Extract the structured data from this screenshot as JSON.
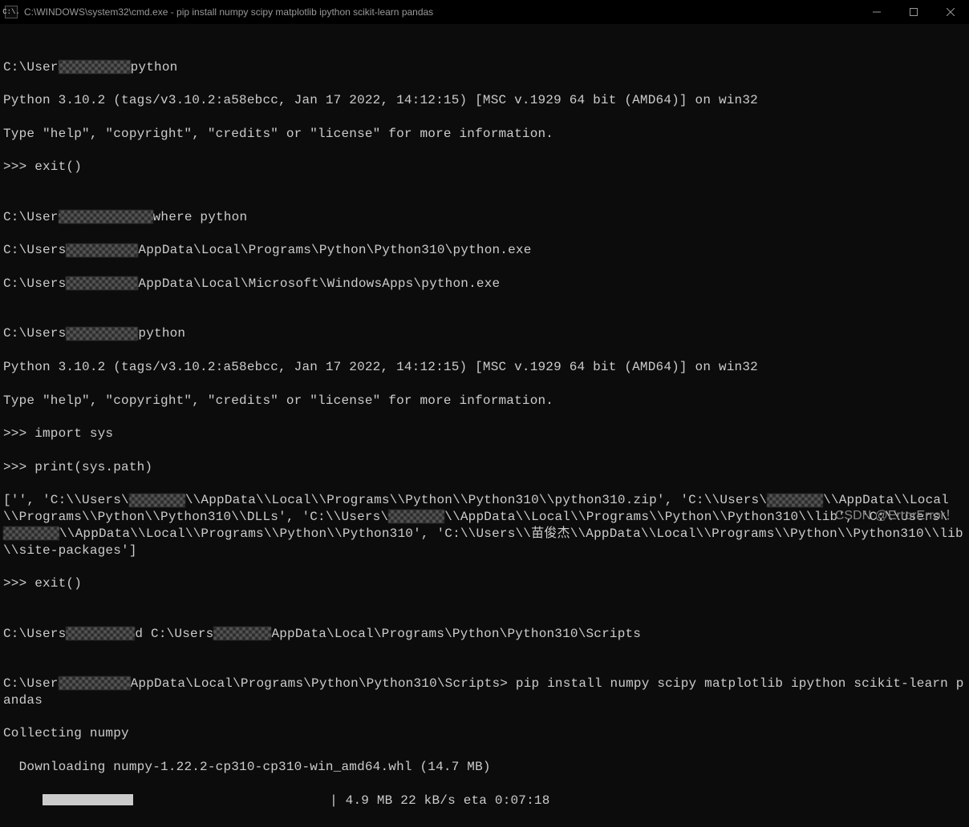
{
  "window": {
    "title": "C:\\WINDOWS\\system32\\cmd.exe - pip  install numpy scipy matplotlib ipython scikit-learn pandas",
    "icon_label": "C:\\."
  },
  "terminal": {
    "blank0": "",
    "line1_pre": "C:\\User",
    "line1_post": "python",
    "line2": "Python 3.10.2 (tags/v3.10.2:a58ebcc, Jan 17 2022, 14:12:15) [MSC v.1929 64 bit (AMD64)] on win32",
    "line3": "Type \"help\", \"copyright\", \"credits\" or \"license\" for more information.",
    "line4": ">>> exit()",
    "blank1": "",
    "line5_pre": "C:\\User",
    "line5_post": "where python",
    "line6_pre": "C:\\Users",
    "line6_post": "AppData\\Local\\Programs\\Python\\Python310\\python.exe",
    "line7_pre": "C:\\Users",
    "line7_post": "AppData\\Local\\Microsoft\\WindowsApps\\python.exe",
    "blank2": "",
    "line8_pre": "C:\\Users",
    "line8_post": "python",
    "line9": "Python 3.10.2 (tags/v3.10.2:a58ebcc, Jan 17 2022, 14:12:15) [MSC v.1929 64 bit (AMD64)] on win32",
    "line10": "Type \"help\", \"copyright\", \"credits\" or \"license\" for more information.",
    "line11": ">>> import sys",
    "line12": ">>> print(sys.path)",
    "line13_a": "['', 'C:\\\\Users\\",
    "line13_b": "\\\\AppData\\\\Local\\\\Programs\\\\Python\\\\Python310\\\\python310.zip', 'C:\\\\Users\\",
    "line13_c": "\\\\AppData\\\\Local\\\\Programs\\\\Python\\\\Python310\\\\DLLs', 'C:\\\\Users\\",
    "line13_d": "\\\\AppData\\\\Local\\\\Programs\\\\Python\\\\Python310\\\\lib', 'C:\\\\Users\\",
    "line13_e": "\\\\AppData\\\\Local\\\\Programs\\\\Python\\\\Python310', 'C:\\\\Users\\\\苗俊杰\\\\AppData\\\\Local\\\\Programs\\\\Python\\\\Python310\\\\lib\\\\site-packages']",
    "line14": ">>> exit()",
    "blank3": "",
    "line15_pre": "C:\\Users",
    "line15_mid": "d C:\\Users",
    "line15_post": "AppData\\Local\\Programs\\Python\\Python310\\Scripts",
    "blank4": "",
    "line16_pre": "C:\\User",
    "line16_post": "AppData\\Local\\Programs\\Python\\Python310\\Scripts> pip install numpy scipy matplotlib ipython scikit-learn pandas",
    "line17": "Collecting numpy",
    "line18": "  Downloading numpy-1.22.2-cp310-cp310-win_amd64.whl (14.7 MB)",
    "progress_prefix": "     ",
    "progress_filled_width": "113",
    "progress_total_chars": "                         ",
    "progress_stats": "| 4.9 MB 22 kB/s eta 0:07:18"
  },
  "watermark": "CSDN @ErrorError！"
}
